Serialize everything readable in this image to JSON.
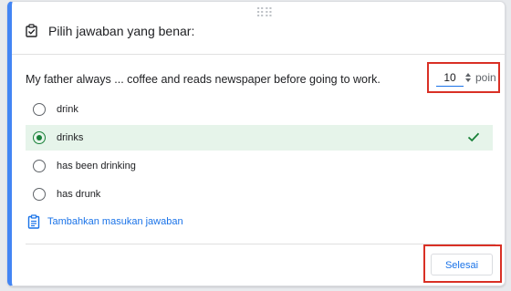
{
  "header": {
    "title": "Pilih jawaban yang benar:",
    "icon": "checkbox-icon"
  },
  "question": {
    "text": "My father always ... coffee and reads newspaper before going to work.",
    "points_value": "10",
    "points_label": "poin"
  },
  "options": [
    {
      "label": "drink",
      "checked": false,
      "correct": false
    },
    {
      "label": "drinks",
      "checked": true,
      "correct": true
    },
    {
      "label": "has been drinking",
      "checked": false,
      "correct": false
    },
    {
      "label": "has drunk",
      "checked": false,
      "correct": false
    }
  ],
  "feedback": {
    "label": "Tambahkan masukan jawaban",
    "icon": "clipboard-icon"
  },
  "footer": {
    "done_label": "Selesai"
  },
  "colors": {
    "accent": "#4285f4",
    "correct_bg": "#e6f4ea",
    "correct_green": "#188038",
    "link_blue": "#1a73e8",
    "highlight_red": "#d93025"
  }
}
